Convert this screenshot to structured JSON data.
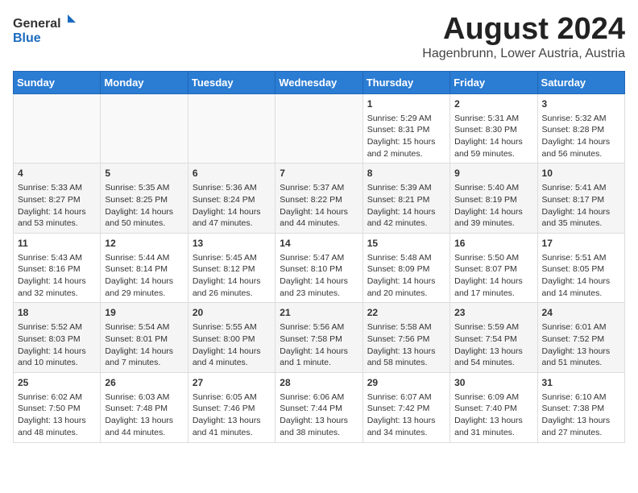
{
  "header": {
    "logo_general": "General",
    "logo_blue": "Blue",
    "month_year": "August 2024",
    "location": "Hagenbrunn, Lower Austria, Austria"
  },
  "days_of_week": [
    "Sunday",
    "Monday",
    "Tuesday",
    "Wednesday",
    "Thursday",
    "Friday",
    "Saturday"
  ],
  "weeks": [
    [
      {
        "day": "",
        "empty": true
      },
      {
        "day": "",
        "empty": true
      },
      {
        "day": "",
        "empty": true
      },
      {
        "day": "",
        "empty": true
      },
      {
        "day": "1",
        "sunrise": "Sunrise: 5:29 AM",
        "sunset": "Sunset: 8:31 PM",
        "daylight": "Daylight: 15 hours and 2 minutes."
      },
      {
        "day": "2",
        "sunrise": "Sunrise: 5:31 AM",
        "sunset": "Sunset: 8:30 PM",
        "daylight": "Daylight: 14 hours and 59 minutes."
      },
      {
        "day": "3",
        "sunrise": "Sunrise: 5:32 AM",
        "sunset": "Sunset: 8:28 PM",
        "daylight": "Daylight: 14 hours and 56 minutes."
      }
    ],
    [
      {
        "day": "4",
        "sunrise": "Sunrise: 5:33 AM",
        "sunset": "Sunset: 8:27 PM",
        "daylight": "Daylight: 14 hours and 53 minutes."
      },
      {
        "day": "5",
        "sunrise": "Sunrise: 5:35 AM",
        "sunset": "Sunset: 8:25 PM",
        "daylight": "Daylight: 14 hours and 50 minutes."
      },
      {
        "day": "6",
        "sunrise": "Sunrise: 5:36 AM",
        "sunset": "Sunset: 8:24 PM",
        "daylight": "Daylight: 14 hours and 47 minutes."
      },
      {
        "day": "7",
        "sunrise": "Sunrise: 5:37 AM",
        "sunset": "Sunset: 8:22 PM",
        "daylight": "Daylight: 14 hours and 44 minutes."
      },
      {
        "day": "8",
        "sunrise": "Sunrise: 5:39 AM",
        "sunset": "Sunset: 8:21 PM",
        "daylight": "Daylight: 14 hours and 42 minutes."
      },
      {
        "day": "9",
        "sunrise": "Sunrise: 5:40 AM",
        "sunset": "Sunset: 8:19 PM",
        "daylight": "Daylight: 14 hours and 39 minutes."
      },
      {
        "day": "10",
        "sunrise": "Sunrise: 5:41 AM",
        "sunset": "Sunset: 8:17 PM",
        "daylight": "Daylight: 14 hours and 35 minutes."
      }
    ],
    [
      {
        "day": "11",
        "sunrise": "Sunrise: 5:43 AM",
        "sunset": "Sunset: 8:16 PM",
        "daylight": "Daylight: 14 hours and 32 minutes."
      },
      {
        "day": "12",
        "sunrise": "Sunrise: 5:44 AM",
        "sunset": "Sunset: 8:14 PM",
        "daylight": "Daylight: 14 hours and 29 minutes."
      },
      {
        "day": "13",
        "sunrise": "Sunrise: 5:45 AM",
        "sunset": "Sunset: 8:12 PM",
        "daylight": "Daylight: 14 hours and 26 minutes."
      },
      {
        "day": "14",
        "sunrise": "Sunrise: 5:47 AM",
        "sunset": "Sunset: 8:10 PM",
        "daylight": "Daylight: 14 hours and 23 minutes."
      },
      {
        "day": "15",
        "sunrise": "Sunrise: 5:48 AM",
        "sunset": "Sunset: 8:09 PM",
        "daylight": "Daylight: 14 hours and 20 minutes."
      },
      {
        "day": "16",
        "sunrise": "Sunrise: 5:50 AM",
        "sunset": "Sunset: 8:07 PM",
        "daylight": "Daylight: 14 hours and 17 minutes."
      },
      {
        "day": "17",
        "sunrise": "Sunrise: 5:51 AM",
        "sunset": "Sunset: 8:05 PM",
        "daylight": "Daylight: 14 hours and 14 minutes."
      }
    ],
    [
      {
        "day": "18",
        "sunrise": "Sunrise: 5:52 AM",
        "sunset": "Sunset: 8:03 PM",
        "daylight": "Daylight: 14 hours and 10 minutes."
      },
      {
        "day": "19",
        "sunrise": "Sunrise: 5:54 AM",
        "sunset": "Sunset: 8:01 PM",
        "daylight": "Daylight: 14 hours and 7 minutes."
      },
      {
        "day": "20",
        "sunrise": "Sunrise: 5:55 AM",
        "sunset": "Sunset: 8:00 PM",
        "daylight": "Daylight: 14 hours and 4 minutes."
      },
      {
        "day": "21",
        "sunrise": "Sunrise: 5:56 AM",
        "sunset": "Sunset: 7:58 PM",
        "daylight": "Daylight: 14 hours and 1 minute."
      },
      {
        "day": "22",
        "sunrise": "Sunrise: 5:58 AM",
        "sunset": "Sunset: 7:56 PM",
        "daylight": "Daylight: 13 hours and 58 minutes."
      },
      {
        "day": "23",
        "sunrise": "Sunrise: 5:59 AM",
        "sunset": "Sunset: 7:54 PM",
        "daylight": "Daylight: 13 hours and 54 minutes."
      },
      {
        "day": "24",
        "sunrise": "Sunrise: 6:01 AM",
        "sunset": "Sunset: 7:52 PM",
        "daylight": "Daylight: 13 hours and 51 minutes."
      }
    ],
    [
      {
        "day": "25",
        "sunrise": "Sunrise: 6:02 AM",
        "sunset": "Sunset: 7:50 PM",
        "daylight": "Daylight: 13 hours and 48 minutes."
      },
      {
        "day": "26",
        "sunrise": "Sunrise: 6:03 AM",
        "sunset": "Sunset: 7:48 PM",
        "daylight": "Daylight: 13 hours and 44 minutes."
      },
      {
        "day": "27",
        "sunrise": "Sunrise: 6:05 AM",
        "sunset": "Sunset: 7:46 PM",
        "daylight": "Daylight: 13 hours and 41 minutes."
      },
      {
        "day": "28",
        "sunrise": "Sunrise: 6:06 AM",
        "sunset": "Sunset: 7:44 PM",
        "daylight": "Daylight: 13 hours and 38 minutes."
      },
      {
        "day": "29",
        "sunrise": "Sunrise: 6:07 AM",
        "sunset": "Sunset: 7:42 PM",
        "daylight": "Daylight: 13 hours and 34 minutes."
      },
      {
        "day": "30",
        "sunrise": "Sunrise: 6:09 AM",
        "sunset": "Sunset: 7:40 PM",
        "daylight": "Daylight: 13 hours and 31 minutes."
      },
      {
        "day": "31",
        "sunrise": "Sunrise: 6:10 AM",
        "sunset": "Sunset: 7:38 PM",
        "daylight": "Daylight: 13 hours and 27 minutes."
      }
    ]
  ]
}
